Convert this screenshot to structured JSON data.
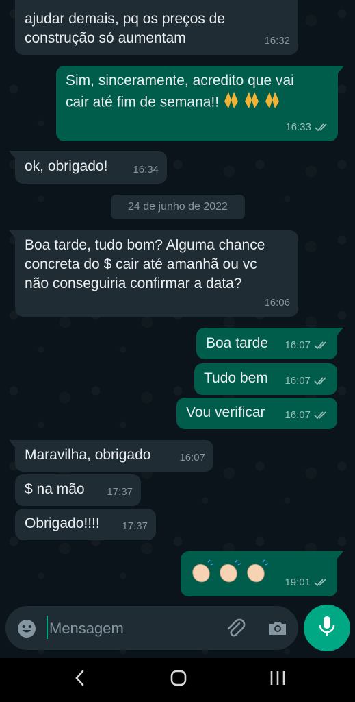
{
  "messages": [
    {
      "id": "m1",
      "direction": "in",
      "text": "ajudar demais, pq os preços de\nconstrução só aumentam",
      "time": "16:32"
    },
    {
      "id": "m2",
      "direction": "out",
      "text": "Sim, sinceramente, acredito que vai\ncair até fim de semana!!",
      "emoji": "folded-hands x3",
      "time": "16:33",
      "status": "read"
    },
    {
      "id": "m3",
      "direction": "in",
      "text": "ok, obrigado!",
      "time": "16:34"
    },
    {
      "id": "m4",
      "direction": "in",
      "text": "Boa tarde, tudo bom? Alguma chance\nconcreta do $ cair até amanhã ou vc\nnão conseguiria confirmar a data?",
      "time": "16:06"
    },
    {
      "id": "m5",
      "direction": "out",
      "text": "Boa tarde",
      "time": "16:07",
      "status": "read"
    },
    {
      "id": "m6",
      "direction": "out",
      "text": "Tudo bem",
      "time": "16:07",
      "status": "read"
    },
    {
      "id": "m7",
      "direction": "out",
      "text": "Vou verificar",
      "time": "16:07",
      "status": "read"
    },
    {
      "id": "m8",
      "direction": "in",
      "text": "Maravilha, obrigado",
      "time": "16:07"
    },
    {
      "id": "m9",
      "direction": "in",
      "text": "$ na mão",
      "time": "17:37"
    },
    {
      "id": "m10",
      "direction": "in",
      "text": "Obrigado!!!!",
      "time": "17:37"
    },
    {
      "id": "m11",
      "direction": "out",
      "emoji": "clapping-hands x3",
      "time": "19:01",
      "status": "read"
    }
  ],
  "date_separator": "24 de junho de 2022",
  "composer": {
    "placeholder": "Mensagem"
  },
  "icons": {
    "emoji": "emoji-icon",
    "attach": "paperclip-icon",
    "camera": "camera-icon",
    "mic": "microphone-icon",
    "nav_back": "chevron-left-icon",
    "nav_home": "home-icon",
    "nav_recents": "recents-icon"
  },
  "colors": {
    "background": "#0b141a",
    "incoming_bubble": "#1f2c33",
    "outgoing_bubble": "#005c4b",
    "accent": "#00a884",
    "text": "#e9edef",
    "meta_text": "#8696a0"
  }
}
